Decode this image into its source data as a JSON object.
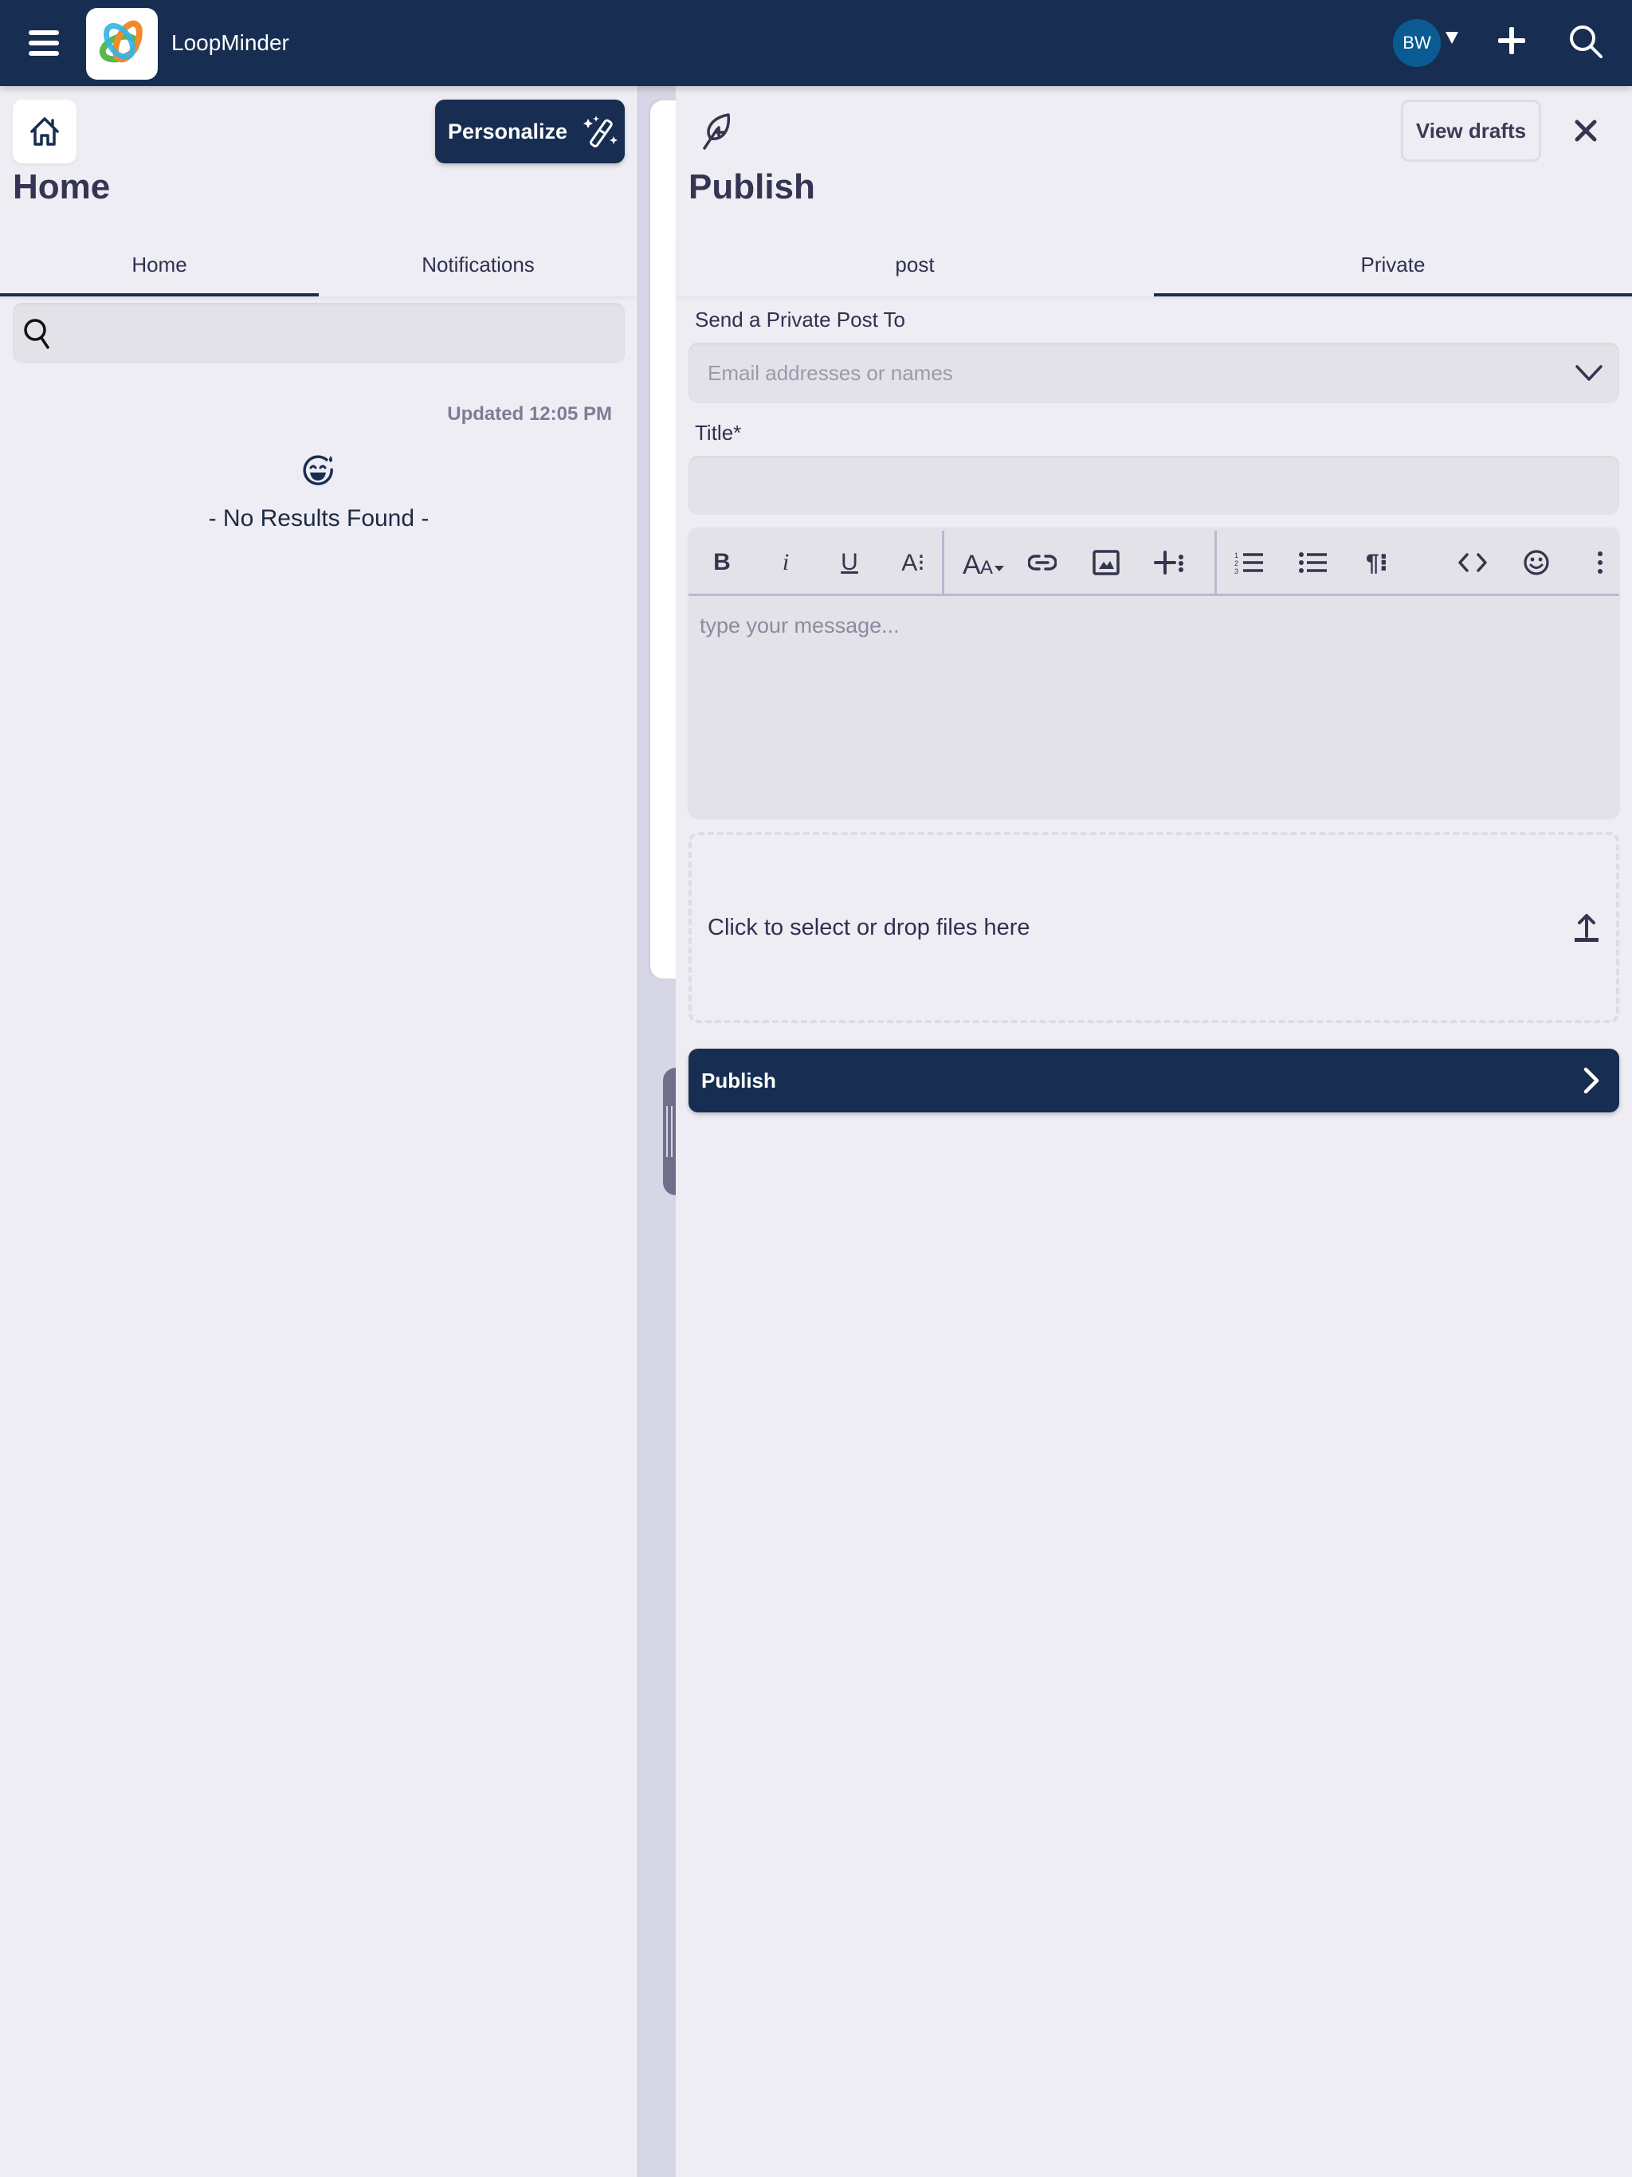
{
  "topbar": {
    "app_name": "LoopMinder",
    "avatar_initials": "BW",
    "icons": [
      "hamburger-menu-icon",
      "app-logo",
      "caret-down-icon",
      "plus-icon",
      "search-icon"
    ],
    "colors": {
      "bar": "#172e52",
      "avatar": "#0a5b93"
    }
  },
  "home": {
    "personalize_label": "Personalize",
    "title": "Home",
    "tabs": [
      {
        "label": "Home",
        "active": true
      },
      {
        "label": "Notifications",
        "active": false
      }
    ],
    "search": {
      "value": "",
      "placeholder": ""
    },
    "updated_text": "Updated 12:05 PM",
    "empty_text": "- No Results Found -"
  },
  "publish": {
    "title": "Publish",
    "view_drafts_label": "View drafts",
    "tabs": [
      {
        "label": "post",
        "active": false
      },
      {
        "label": "Private",
        "active": true
      }
    ],
    "recipient_label": "Send a Private Post To",
    "recipient_placeholder": "Email addresses or names",
    "recipient_value": "",
    "title_label": "Title*",
    "title_value": "",
    "editor": {
      "placeholder": "type your message...",
      "toolbar": [
        "bold",
        "italic",
        "underline",
        "text-style-more",
        "font-size",
        "link",
        "image",
        "insert-more",
        "ordered-list",
        "bullet-list",
        "paragraph-more",
        "code",
        "emoji",
        "more-options"
      ],
      "bold_glyph": "B",
      "italic_glyph": "i",
      "underline_glyph": "U",
      "textstyle_glyph": "A⁝",
      "paragraph_glyph": "¶⁝"
    },
    "dropzone_text": "Click to select or drop files here",
    "submit_label": "Publish"
  }
}
